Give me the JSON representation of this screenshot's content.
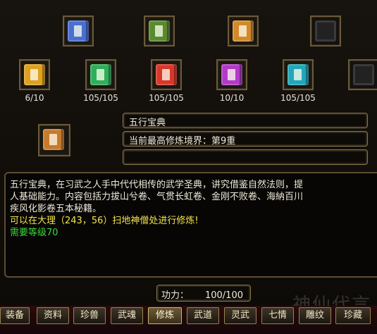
{
  "top_slots": [
    {
      "icon": "colorful-books-icon",
      "color": "#4a6fd1",
      "empty": false
    },
    {
      "icon": "scroll-bundle-icon",
      "color": "#5a8a2e",
      "empty": false
    },
    {
      "icon": "golden-chest-icon",
      "color": "#d2892a",
      "empty": false
    },
    {
      "icon": "empty-slot-icon",
      "color": "#2a2a2a",
      "empty": true
    }
  ],
  "book_slots": [
    {
      "icon": "yellow-book-icon",
      "color": "#e0a020",
      "count": "6/10"
    },
    {
      "icon": "green-book-icon",
      "color": "#2fae5a",
      "count": "105/105"
    },
    {
      "icon": "red-book-icon",
      "color": "#d8382a",
      "count": "105/105"
    },
    {
      "icon": "purple-book-icon",
      "color": "#b23ac8",
      "count": "10/10"
    },
    {
      "icon": "cyan-book-icon",
      "color": "#22a6b8",
      "count": "105/105"
    },
    {
      "icon": "empty-slot-icon",
      "color": "#2a2a2a",
      "count": ""
    }
  ],
  "selected": {
    "icon": "five-elements-book-icon",
    "color": "#c77a2a",
    "name": "五行宝典",
    "realm": "当前最高修炼境界：第9重",
    "extra": ""
  },
  "description": {
    "line1": "五行宝典，在习武之人手中代代相传的武学圣典，讲究借鉴自然法则，提",
    "line2": "人基础能力。内容包括力拔山兮卷、气贯长虹卷、金刚不败卷、海納百川",
    "line3": "疾风化影卷五本秘籍。",
    "location": "可以在大理（243，56）扫地神僧处进行修炼!",
    "requirement": "需要等级70"
  },
  "power": {
    "label": "功力：",
    "value": "100/100"
  },
  "tabs": [
    "装备",
    "资料",
    "珍兽",
    "武魂",
    "修炼",
    "武道",
    "灵武",
    "七情",
    "雕纹",
    "珍藏"
  ],
  "active_tab": 4,
  "watermark": "神仙代言"
}
